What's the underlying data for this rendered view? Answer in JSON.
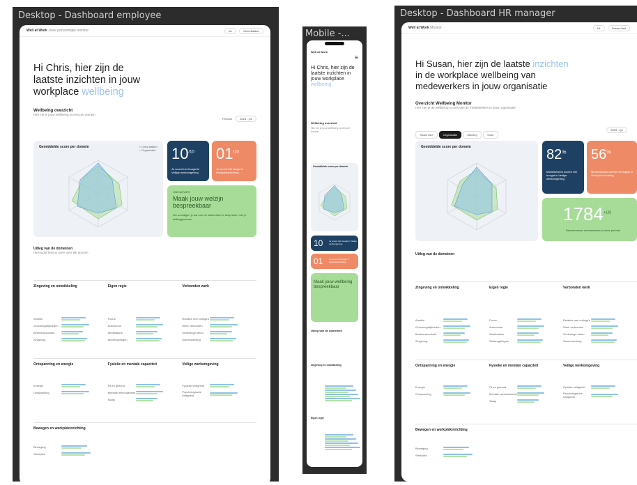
{
  "frames": {
    "employee_title": "Desktop - Dashboard employee",
    "mobile_title": "Mobile -...",
    "hr_title": "Desktop - Dashboard HR manager"
  },
  "employee": {
    "brand": "Well at Work",
    "brand_sub": "Jouw persoonlijke monitor",
    "lang": "NL",
    "user": "Chris Bakker",
    "greeting_1": "Hi Chris, hier zijn de",
    "greeting_2": "laatste inzichten in jouw",
    "greeting_3": "workplace",
    "greeting_accent": "wellbeing",
    "overview_title": "Wellbeing overzicht",
    "overview_text": "Hier zie je jouw wellbeing scores per domein",
    "period_label": "Periode",
    "period_value": "2023 - Q1",
    "chart_title": "Gemiddelde score per domein",
    "legend_1": "Chris Bakker",
    "legend_2": "Organisatie",
    "score_1": "10",
    "score_1_sup": "/10",
    "score_1_text": "Je scoort het hoogst in Veilige werkomgeving",
    "score_2": "01",
    "score_2_sup": "/10",
    "score_2_text": "Je scoort het laagst in Werkplekinrichting",
    "tip_tag": "ONS ADVIES",
    "tip_title": "Maak jouw welzijn bespreekbaar",
    "tip_text": "We moedigen je aan om de uitkomsten te bespreken met je leidinggevende.",
    "domains_title": "Uitleg van de domeinen",
    "domains_text": "Hieronder lees je meer over elk domein",
    "cols": [
      {
        "title": "Zingeving en ontwikkeling",
        "rows": [
          "Ambitie",
          "Groeimogelijkheden",
          "Betekenisvolheid",
          "Zingeving"
        ]
      },
      {
        "title": "Eigen regie",
        "rows": [
          "Focus",
          "Autonomie",
          "Werkbalans",
          "Werkregelingen"
        ]
      },
      {
        "title": "Verbonden werk",
        "rows": [
          "Relaties met collega's",
          "Werk verbonden",
          "Onderlinge steun",
          "Samenwerking"
        ]
      }
    ],
    "cols2": [
      {
        "title": "Ontspanning en energie",
        "rows": [
          "Energie",
          "Ontspanning"
        ]
      },
      {
        "title": "Fysieke en mentale capaciteit",
        "rows": [
          "Fit en gezond",
          "Mentale weerbaarheid",
          "Slaap"
        ]
      },
      {
        "title": "Veilige werkomgeving",
        "rows": [
          "Fysieke veiligheid",
          "Psychologische veiligheid"
        ]
      }
    ],
    "last_title": "Bewegen en werkplekinrichting",
    "last_rows": [
      "Beweging",
      "Werkplek"
    ]
  },
  "mobile": {
    "brand": "Well at Work",
    "greeting": "Hi Chris, hier zijn de laatste inzichten in jouw workplace",
    "greeting_accent": "wellbeing",
    "overview_title": "Wellbeing overzicht",
    "chart_title": "Gemiddelde score per domein",
    "score_1": "10",
    "score_1_text": "Je scoort het hoogst in Veilige werkomgeving",
    "score_2": "01",
    "score_2_text": "Je scoort het laagst in Werkplekinrichting",
    "tip_title": "Maak jouw wellbeing bespreekbaar",
    "domains_title": "Uitleg van de domeinen",
    "sec_1": "Zingeving en ontwikkeling",
    "sec_2": "Eigen regie"
  },
  "hr": {
    "brand": "Well at Work",
    "brand_sub": "Monitor",
    "lang": "NL",
    "user": "Susan Hart",
    "greeting_1": "Hi Susan, hier zijn de laatste",
    "greeting_accent": "inzichten",
    "greeting_2": "in de workplace wellbeing van",
    "greeting_3": "medewerkers in jouw organisatie",
    "overview_title": "Overzicht Wellbeing Monitor",
    "overview_text": "Hier ziet je de wellbeing scores van de medewerkers in jouw organisatie",
    "tabs": [
      "Totaal view",
      "Organisatie",
      "Afdeling",
      "Team"
    ],
    "period_value": "2023 - Q1",
    "chart_title": "Gemiddelde score per domein",
    "score_1": "82",
    "score_1_sup": "%",
    "score_1_text": "Medewerkers scoren het hoogst in Veilige werkomgeving",
    "score_2": "56",
    "score_2_sup": "%",
    "score_2_text": "Medewerkers scoren het laagst in Werkplekinrichting",
    "score_3": "1784",
    "score_3_sup": "+120",
    "score_3_text": "Deelnemende medewerkers in deze periode",
    "domains_title": "Uitleg van de domeinen",
    "cols": [
      {
        "title": "Zingeving en ontwikkeling",
        "rows": [
          "Ambitie",
          "Groeimogelijkheden",
          "Betekenisvolheid",
          "Zingeving"
        ]
      },
      {
        "title": "Eigen regie",
        "rows": [
          "Focus",
          "Autonomie",
          "Werkbalans",
          "Werkregelingen"
        ]
      },
      {
        "title": "Verbonden werk",
        "rows": [
          "Relaties met collega's",
          "Werk verbonden",
          "Onderlinge steun",
          "Samenwerking"
        ]
      }
    ],
    "cols2": [
      {
        "title": "Ontspanning en energie",
        "rows": [
          "Energie",
          "Ontspanning"
        ]
      },
      {
        "title": "Fysieke en mentale capaciteit",
        "rows": [
          "Fit en gezond",
          "Mentale weerbaarheid",
          "Slaap"
        ]
      },
      {
        "title": "Veilige werkomgeving",
        "rows": [
          "Fysieke veiligheid",
          "Psychologische veiligheid"
        ]
      }
    ],
    "last_title": "Bewegen en werkplekinrichting",
    "last_rows": [
      "Beweging",
      "Werkplek"
    ]
  },
  "colors": {
    "navy": "#1e4163",
    "orange": "#ef8a66",
    "green": "#a7dc98",
    "accent": "#9cc2ea"
  }
}
